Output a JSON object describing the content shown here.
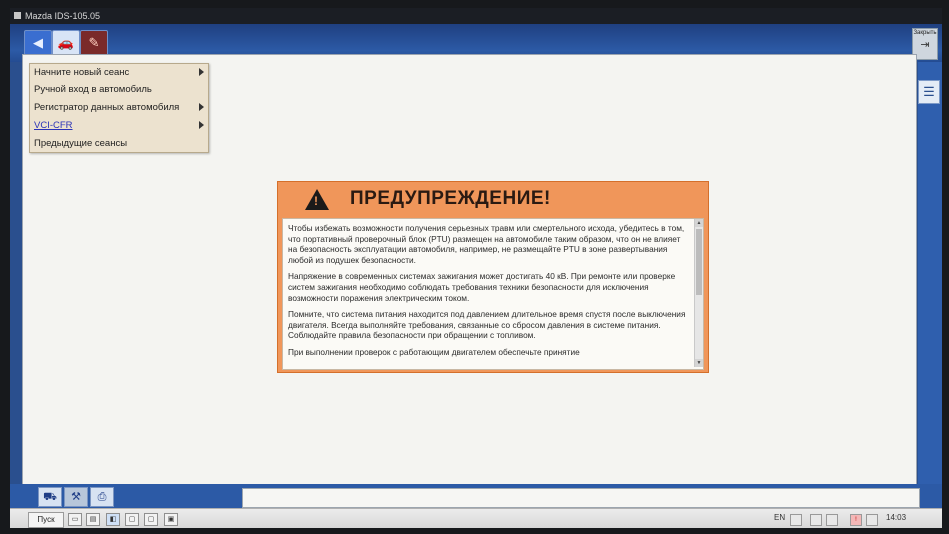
{
  "window": {
    "title": "Mazda IDS-105.05"
  },
  "toolbar": {
    "buttons": [
      {
        "name": "back",
        "icon": "back-arrow-icon"
      },
      {
        "name": "vehicle",
        "icon": "car-icon"
      },
      {
        "name": "toolbox",
        "icon": "toolbox-icon"
      }
    ],
    "close_label": "Закрыть"
  },
  "menu": {
    "items": [
      {
        "label": "Начните новый сеанс",
        "has_submenu": true
      },
      {
        "label": "Ручной вход в автомобиль",
        "has_submenu": false
      },
      {
        "label": "Регистратор данных автомобиля",
        "has_submenu": true
      },
      {
        "label": "VCI-CFR",
        "has_submenu": true,
        "highlighted": true
      },
      {
        "label": "Предыдущие сеансы",
        "has_submenu": false
      }
    ]
  },
  "warning": {
    "title": "ПРЕДУПРЕЖДЕНИЕ!",
    "paragraphs": [
      "Чтобы избежать возможности получения серьезных травм или смертельного исхода, убедитесь в том, что портативный проверочный блок (PTU) размещен на автомобиле таким образом, что он не влияет на безопасность эксплуатации автомобиля, например, не размещайте PTU в зоне развертывания любой из подушек безопасности.",
      "Напряжение в современных системах зажигания может достигать 40 кВ. При ремонте или проверке систем зажигания необходимо соблюдать требования техники безопасности для исключения возможности поражения электрическим током.",
      "Помните, что система питания находится под давлением длительное время спустя после выключения двигателя. Всегда выполняйте требования, связанные со сбросом давления в системе питания. Соблюдайте правила безопасности при обращении с топливом.",
      "При выполнении проверок с работающим двигателем обеспечьте принятие"
    ],
    "accent_color": "#f0965a"
  },
  "taskbar": {
    "start_label": "Пуск",
    "language": "EN",
    "clock": "14:03"
  }
}
